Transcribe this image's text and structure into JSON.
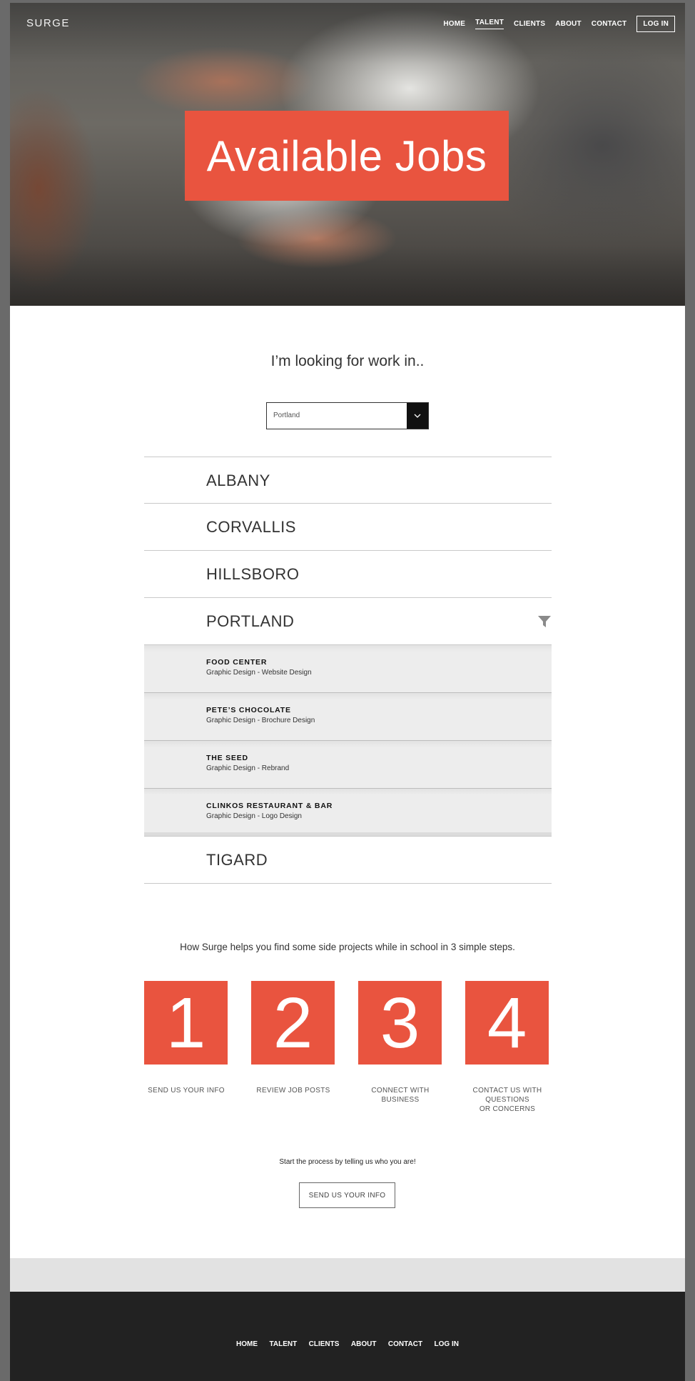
{
  "header": {
    "logo": "SURGE",
    "nav": [
      "HOME",
      "TALENT",
      "CLIENTS",
      "ABOUT",
      "CONTACT",
      "LOG IN"
    ],
    "active_nav": "TALENT"
  },
  "hero": {
    "title": "Available Jobs"
  },
  "search": {
    "prompt": "I’m looking for work in..",
    "selected_city": "Portland"
  },
  "cities": [
    {
      "name": "ALBANY"
    },
    {
      "name": "CORVALLIS"
    },
    {
      "name": "HILLSBORO"
    },
    {
      "name": "PORTLAND"
    },
    {
      "name": "TIGARD"
    }
  ],
  "jobs": [
    {
      "company": "FOOD CENTER",
      "description": "Graphic Design - Website Design"
    },
    {
      "company": "PETE’S CHOCOLATE",
      "description": "Graphic Design - Brochure Design"
    },
    {
      "company": "THE SEED",
      "description": "Graphic Design - Rebrand"
    },
    {
      "company": "CLINKOS RESTAURANT & BAR",
      "description": "Graphic Design - Logo Design"
    }
  ],
  "steps": {
    "intro": "How Surge helps you find some side projects while in school in 3 simple steps.",
    "items": [
      {
        "number": "1",
        "label": "SEND US YOUR INFO"
      },
      {
        "number": "2",
        "label": "REVIEW JOB POSTS"
      },
      {
        "number": "3",
        "label": "CONNECT WITH\nBUSINESS"
      },
      {
        "number": "4",
        "label": "CONTACT US WITH\nQUESTIONS\nOR CONCERNS"
      }
    ]
  },
  "cta": {
    "text": "Start the process by telling us who you are!",
    "button": "SEND US YOUR INFO"
  },
  "footer": {
    "nav": [
      "HOME",
      "TALENT",
      "CLIENTS",
      "ABOUT",
      "CONTACT",
      "LOG IN"
    ]
  },
  "colors": {
    "accent": "#e9543f",
    "footer_bg": "#222222",
    "band_bg": "#e2e2e2"
  },
  "icons": {
    "dropdown": "chevron-down-icon",
    "filter": "funnel-icon"
  }
}
